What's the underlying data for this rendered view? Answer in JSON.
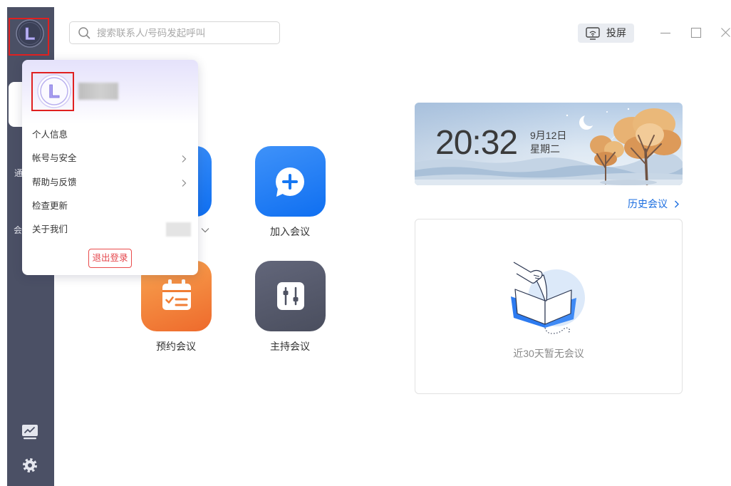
{
  "search": {
    "placeholder": "搜索联系人/号码发起呼叫",
    "icon": "search-icon"
  },
  "cast": {
    "label": "投屏",
    "icon": "screen-cast-icon"
  },
  "window_controls": {
    "minimize_icon": "minimize-icon",
    "maximize_icon": "maximize-icon",
    "close_icon": "close-icon"
  },
  "sidebar": {
    "avatar_letter": "L",
    "items": [
      {
        "label": "通"
      },
      {
        "label": "会"
      }
    ],
    "bottom_icons": [
      "monitor-chart-icon",
      "gear-icon"
    ]
  },
  "profile_menu": {
    "avatar_letter": "L",
    "items": [
      {
        "label": "个人信息",
        "icon": null
      },
      {
        "label": "帐号与安全",
        "icon": "chevron-right-icon"
      },
      {
        "label": "帮助与反馈",
        "icon": "chevron-right-icon"
      },
      {
        "label": "检查更新",
        "icon": null
      },
      {
        "label": "关于我们",
        "icon": null
      }
    ],
    "logout_label": "退出登录"
  },
  "actions": {
    "start": {
      "icon": "chevron-down-icon",
      "color": "#1677f2"
    },
    "join": {
      "label": "加入会议",
      "icon": "join-meeting-icon",
      "color": "#1677f2"
    },
    "schedule": {
      "label": "预约会议",
      "icon": "calendar-icon",
      "color": "#f07e35"
    },
    "host": {
      "label": "主持会议",
      "icon": "sliders-icon",
      "color": "#535768"
    }
  },
  "clock": {
    "time": "20:32",
    "date": "9月12日",
    "weekday": "星期二"
  },
  "history": {
    "label": "历史会议",
    "icon": "chevron-right-icon"
  },
  "empty_state": {
    "message": "近30天暂无会议",
    "icon": "open-book-icon"
  },
  "colors": {
    "sidebar": "#4b5065",
    "accent_blue": "#1a6de0",
    "logout_red": "#e5484d",
    "highlight_red": "#e02020"
  }
}
